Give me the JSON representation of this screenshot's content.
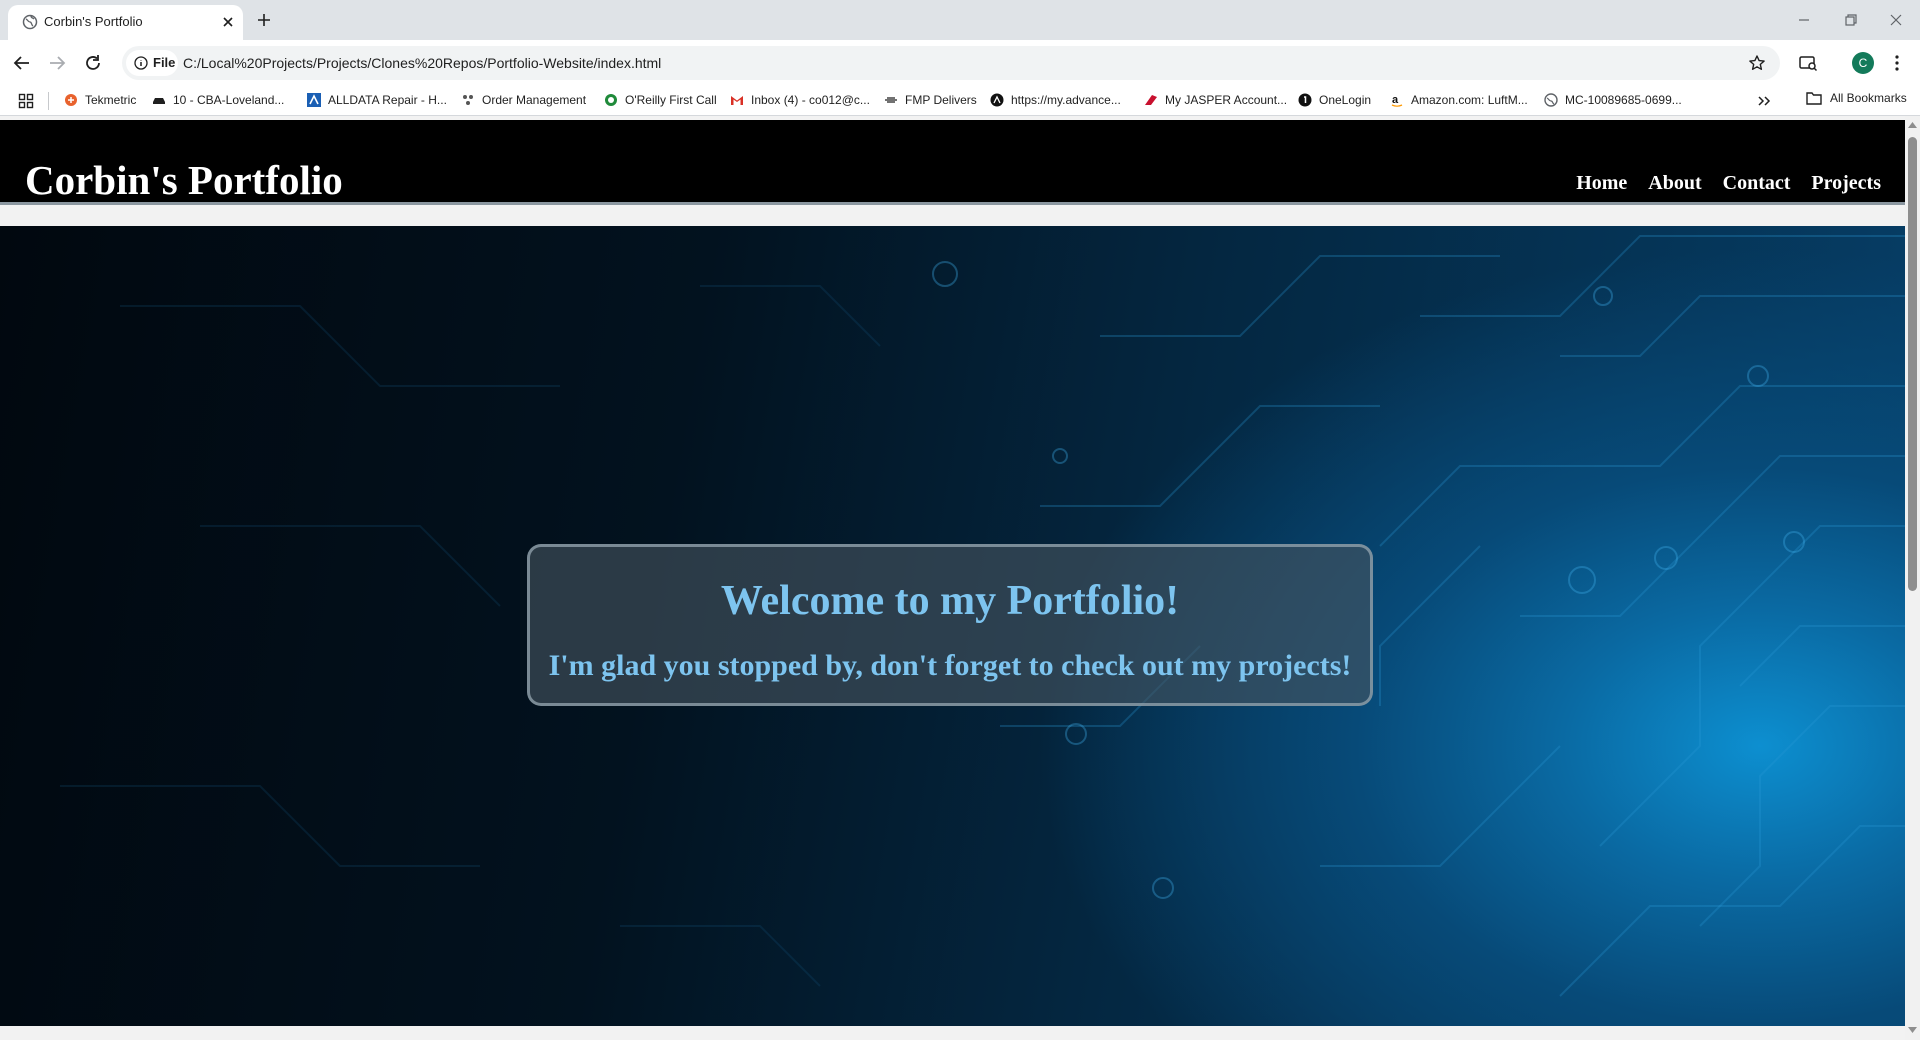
{
  "browser": {
    "tab": {
      "title": "Corbin's Portfolio"
    },
    "address": {
      "chip_label": "File",
      "url": "C:/Local%20Projects/Projects/Clones%20Repos/Portfolio-Website/index.html"
    },
    "profile_initial": "C",
    "bookmarks": [
      {
        "label": "Tekmetric",
        "icon": "tekmetric-icon"
      },
      {
        "label": "10 - CBA-Loveland...",
        "icon": "car-icon"
      },
      {
        "label": "ALLDATA Repair - H...",
        "icon": "alldata-icon"
      },
      {
        "label": "Order Management",
        "icon": "order-icon"
      },
      {
        "label": "O'Reilly First Call",
        "icon": "oreilly-icon"
      },
      {
        "label": "Inbox (4) - co012@c...",
        "icon": "gmail-icon"
      },
      {
        "label": "FMP Delivers",
        "icon": "fmp-icon"
      },
      {
        "label": "https://my.advance...",
        "icon": "advance-icon"
      },
      {
        "label": "My JASPER Account...",
        "icon": "jasper-icon"
      },
      {
        "label": "OneLogin",
        "icon": "onelogin-icon"
      },
      {
        "label": "Amazon.com: LuftM...",
        "icon": "amazon-icon"
      },
      {
        "label": "MC-10089685-0699...",
        "icon": "globe-icon"
      }
    ],
    "all_bookmarks_label": "All Bookmarks"
  },
  "site": {
    "logo": "Corbin's Portfolio",
    "nav": [
      "Home",
      "About",
      "Contact",
      "Projects"
    ],
    "hero": {
      "title": "Welcome to my Portfolio!",
      "subtitle": "I'm glad you stopped by, don't forget to check out my projects!"
    }
  },
  "colors": {
    "accent_text": "#7dc4ef",
    "header_bg": "#000000",
    "hero_dark": "#01080f",
    "hero_light": "#0d8fd0"
  }
}
